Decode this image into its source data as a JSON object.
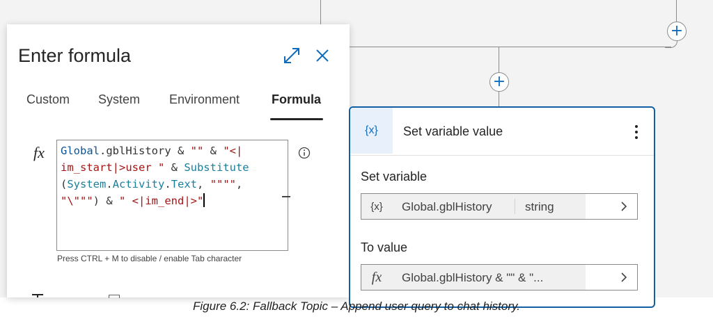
{
  "panel": {
    "title": "Enter formula",
    "tabs": [
      {
        "label": "Custom"
      },
      {
        "label": "System"
      },
      {
        "label": "Environment"
      },
      {
        "label": "Formula",
        "active": true
      }
    ],
    "fx_symbol": "fx",
    "formula": "Global.gblHistory & \"\" & \"<|im_start|>user \" & Substitute(System.Activity.Text, \"\"\"\", \"\\\"\"\") & \" <|im_end|>\"",
    "formula_display": {
      "l1_a": "Global",
      "l1_b": ".gblHistory & ",
      "l1_c": "\"\"",
      "l1_d": " & ",
      "l1_e": "\"<|",
      "l2_a": "im_start|>user \"",
      "l2_b": " & ",
      "l2_c": "Substitute",
      "l3_a": "(",
      "l3_b": "System",
      "l3_c": ".",
      "l3_d": "Activity",
      "l3_e": ".",
      "l3_f": "Text",
      "l3_g": ", ",
      "l3_h": "\"\"\"\"",
      "l3_i": ",",
      "l4_a": "\"\\\"\"\"",
      "l4_b": ") & ",
      "l4_c": "\" <|im_end|>\""
    },
    "hint": "Press CTRL + M to disable / enable Tab character"
  },
  "card": {
    "icon": "{x}",
    "title": "Set variable value",
    "set_variable_label": "Set variable",
    "variable_icon": "{x}",
    "variable_name": "Global.gblHistory",
    "variable_type": "string",
    "to_value_label": "To value",
    "value_fx": "fx",
    "value_preview": "Global.gblHistory & \"\" & \"..."
  },
  "caption": "Figure 6.2: Fallback Topic – Append user query to chat history.",
  "colors": {
    "accent": "#0f6cbd",
    "card_border": "#115ea3"
  }
}
